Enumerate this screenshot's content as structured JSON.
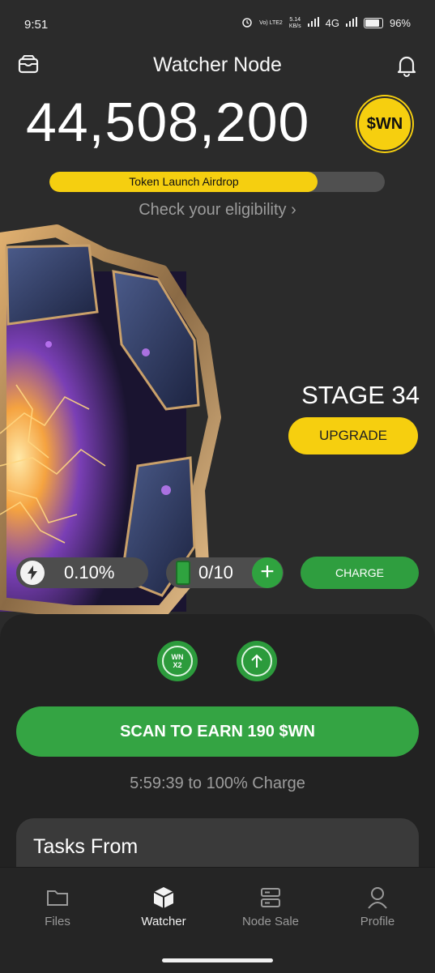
{
  "status": {
    "time": "9:51",
    "network_top": "Vo) LTE2",
    "speed_value": "5.14",
    "speed_unit": "KB/s",
    "network": "4G",
    "battery": "96%"
  },
  "header": {
    "title": "Watcher Node"
  },
  "balance": {
    "amount": "44,508,200",
    "token": "$WN"
  },
  "airdrop": {
    "label": "Token Launch Airdrop",
    "progress": 0.8,
    "link": "Check your eligibility ›"
  },
  "stage": {
    "label": "STAGE 34",
    "upgrade": "UPGRADE"
  },
  "stats": {
    "rate": "0.10%",
    "battery": "0/10",
    "plus": "+",
    "charge": "CHARGE"
  },
  "boosts": {
    "x2_top": "WN",
    "x2_bottom": "X2"
  },
  "scan": {
    "label": "SCAN TO EARN 190 $WN",
    "countdown": "5:59:39 to 100% Charge"
  },
  "tasks": {
    "title": "Tasks From"
  },
  "nav": [
    {
      "label": "Files",
      "icon": "folder-icon"
    },
    {
      "label": "Watcher",
      "icon": "cube-icon"
    },
    {
      "label": "Node Sale",
      "icon": "server-icon"
    },
    {
      "label": "Profile",
      "icon": "person-icon"
    }
  ],
  "colors": {
    "accent_yellow": "#f6cf0f",
    "accent_green": "#34a443",
    "background": "#2b2b2b"
  }
}
